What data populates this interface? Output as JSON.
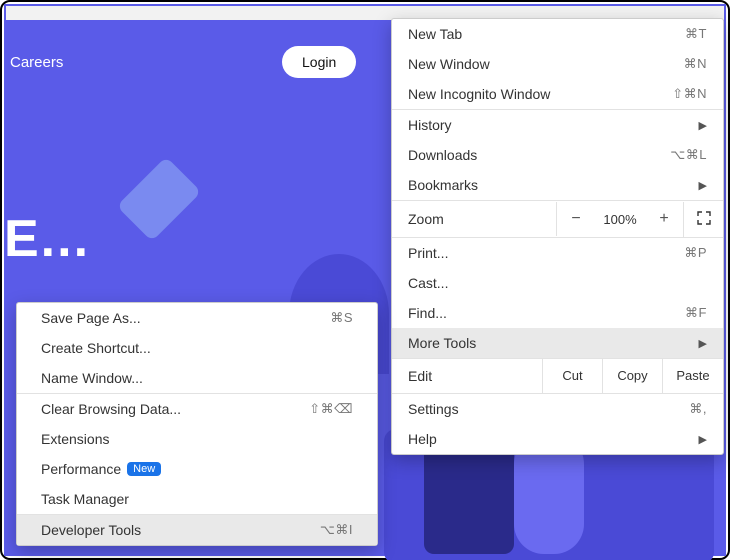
{
  "page": {
    "careers": "Careers",
    "login": "Login",
    "hero": "E..."
  },
  "mainMenu": {
    "newTab": {
      "label": "New Tab",
      "shortcut": "⌘T"
    },
    "newWindow": {
      "label": "New Window",
      "shortcut": "⌘N"
    },
    "newIncognito": {
      "label": "New Incognito Window",
      "shortcut": "⇧⌘N"
    },
    "history": {
      "label": "History"
    },
    "downloads": {
      "label": "Downloads",
      "shortcut": "⌥⌘L"
    },
    "bookmarks": {
      "label": "Bookmarks"
    },
    "zoom": {
      "label": "Zoom",
      "minus": "−",
      "pct": "100%",
      "plus": "+"
    },
    "print": {
      "label": "Print...",
      "shortcut": "⌘P"
    },
    "cast": {
      "label": "Cast..."
    },
    "find": {
      "label": "Find...",
      "shortcut": "⌘F"
    },
    "moreTools": {
      "label": "More Tools"
    },
    "edit": {
      "label": "Edit",
      "cut": "Cut",
      "copy": "Copy",
      "paste": "Paste"
    },
    "settings": {
      "label": "Settings",
      "shortcut": "⌘,"
    },
    "help": {
      "label": "Help"
    }
  },
  "subMenu": {
    "savePage": {
      "label": "Save Page As...",
      "shortcut": "⌘S"
    },
    "createShortcut": {
      "label": "Create Shortcut..."
    },
    "nameWindow": {
      "label": "Name Window..."
    },
    "clearBrowsing": {
      "label": "Clear Browsing Data...",
      "shortcut": "⇧⌘⌫"
    },
    "extensions": {
      "label": "Extensions"
    },
    "performance": {
      "label": "Performance",
      "badge": "New"
    },
    "taskManager": {
      "label": "Task Manager"
    },
    "devTools": {
      "label": "Developer Tools",
      "shortcut": "⌥⌘I"
    }
  }
}
